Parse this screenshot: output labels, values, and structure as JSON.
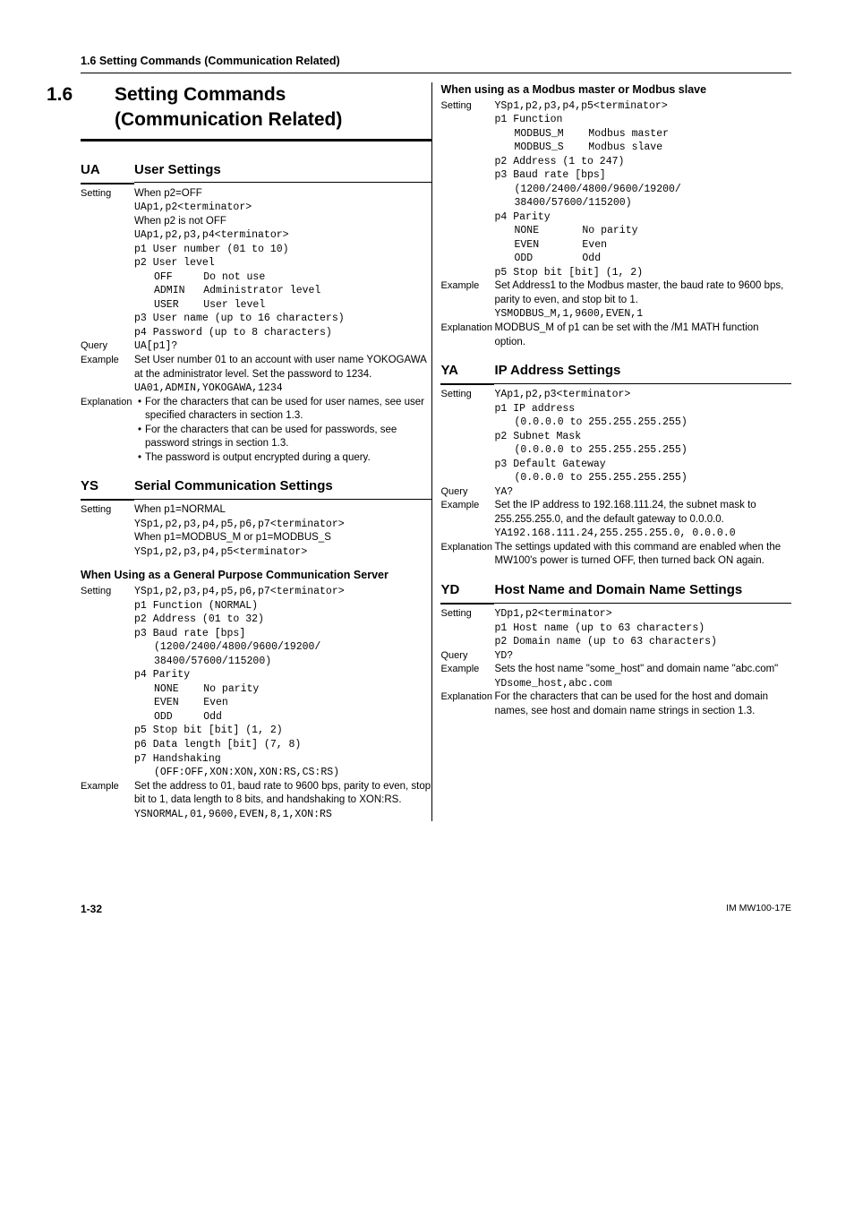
{
  "header": {
    "section": "1.6  Setting Commands (Communication Related)"
  },
  "title": {
    "num": "1.6",
    "text": "Setting Commands (Communication Related)"
  },
  "ua": {
    "code": "UA",
    "name": "User Settings",
    "setting_l1": "When p2=OFF",
    "setting_l2": "UAp1,p2<terminator>",
    "setting_l3": "When p2 is not OFF",
    "setting_l4": "UAp1,p2,p3,p4<terminator>",
    "p1": "p1  User number (01 to 10)",
    "p2": "p2  User level",
    "p2_off": "OFF     Do not use",
    "p2_admin": "ADMIN   Administrator level",
    "p2_user": "USER    User level",
    "p3": "p3  User name (up to 16 characters)",
    "p4": "p4  Password (up to 8 characters)",
    "query": "UA[p1]?",
    "ex1": "Set User number 01 to an account with user name YOKOGAWA at the administrator level. Set the password to 1234.",
    "ex2": "UA01,ADMIN,YOKOGAWA,1234",
    "exp_b1": "For the characters that can be used for user names, see user specified characters in section 1.3.",
    "exp_b2": "For the characters that can be used for passwords, see password strings in section 1.3.",
    "exp_b3": "The password is output encrypted during a query."
  },
  "ys": {
    "code": "YS",
    "name": "Serial Communication Settings",
    "setting_l1": "When p1=NORMAL",
    "setting_l2": "YSp1,p2,p3,p4,p5,p6,p7<terminator>",
    "setting_l3": "When p1=MODBUS_M or p1=MODBUS_S",
    "setting_l4": "YSp1,p2,p3,p4,p5<terminator>",
    "sub1": "When Using as a General Purpose Communication Server",
    "s1_setting": "YSp1,p2,p3,p4,p5,p6,p7<terminator>",
    "s1_p1": "p1  Function (NORMAL)",
    "s1_p2": "p2  Address (01 to 32)",
    "s1_p3": "p3  Baud rate [bps]",
    "s1_p3b": "(1200/2400/4800/9600/19200/",
    "s1_p3c": "38400/57600/115200)",
    "s1_p4": "p4  Parity",
    "s1_p4_none": "NONE    No parity",
    "s1_p4_even": "EVEN    Even",
    "s1_p4_odd": "ODD     Odd",
    "s1_p5": "p5  Stop bit [bit] (1, 2)",
    "s1_p6": "p6  Data length [bit] (7, 8)",
    "s1_p7": "p7  Handshaking",
    "s1_p7b": "(OFF:OFF,XON:XON,XON:RS,CS:RS)",
    "s1_ex": "Set the address to 01, baud rate to 9600 bps, parity to even, stop bit to 1, data length to 8 bits, and handshaking to XON:RS.",
    "s1_ex2": "YSNORMAL,01,9600,EVEN,8,1,XON:RS",
    "sub2": "When using as a Modbus master or Modbus slave",
    "s2_setting": "YSp1,p2,p3,p4,p5<terminator>",
    "s2_p1": "p1  Function",
    "s2_p1_m": "MODBUS_M    Modbus master",
    "s2_p1_s": "MODBUS_S    Modbus slave",
    "s2_p2": "p2  Address (1 to 247)",
    "s2_p3": "p3  Baud rate [bps]",
    "s2_p3b": "(1200/2400/4800/9600/19200/",
    "s2_p3c": "38400/57600/115200)",
    "s2_p4": "p4  Parity",
    "s2_p4_none": "NONE       No parity",
    "s2_p4_even": "EVEN       Even",
    "s2_p4_odd": "ODD        Odd",
    "s2_p5": "p5  Stop bit [bit] (1, 2)",
    "s2_ex1": "Set Address1 to the Modbus master, the baud rate to 9600 bps, parity to even, and stop bit to 1.",
    "s2_ex2": "YSMODBUS_M,1,9600,EVEN,1",
    "s2_exp": "MODBUS_M of p1 can be set with the /M1 MATH function option."
  },
  "ya": {
    "code": "YA",
    "name": "IP Address  Settings",
    "setting": "YAp1,p2,p3<terminator>",
    "p1": "p1  IP address",
    "p1b": "(0.0.0.0 to 255.255.255.255)",
    "p2": "p2  Subnet Mask",
    "p2b": "(0.0.0.0 to 255.255.255.255)",
    "p3": "p3  Default Gateway",
    "p3b": "(0.0.0.0 to 255.255.255.255)",
    "query": "YA?",
    "ex1": "Set the IP address to 192.168.111.24, the subnet mask to 255.255.255.0, and the default gateway to 0.0.0.0.",
    "ex2": "YA192.168.111.24,255.255.255.0, 0.0.0.0",
    "exp": "The settings updated with this command are enabled when the MW100's power is turned OFF, then turned back ON again."
  },
  "yd": {
    "code": "YD",
    "name": "Host Name and Domain Name Settings",
    "setting": "YDp1,p2<terminator>",
    "p1": "p1  Host name (up to 63 characters)",
    "p2": "p2  Domain name (up to 63 characters)",
    "query": "YD?",
    "ex1": "Sets the host name \"some_host\" and domain name \"abc.com\"",
    "ex2": "YDsome_host,abc.com",
    "exp": "For the characters that can be used for the host and domain names, see host and domain name strings in section 1.3."
  },
  "labels": {
    "setting": "Setting",
    "query": "Query",
    "example": "Example",
    "explanation": "Explanation"
  },
  "footer": {
    "page": "1-32",
    "doc": "IM MW100-17E"
  }
}
